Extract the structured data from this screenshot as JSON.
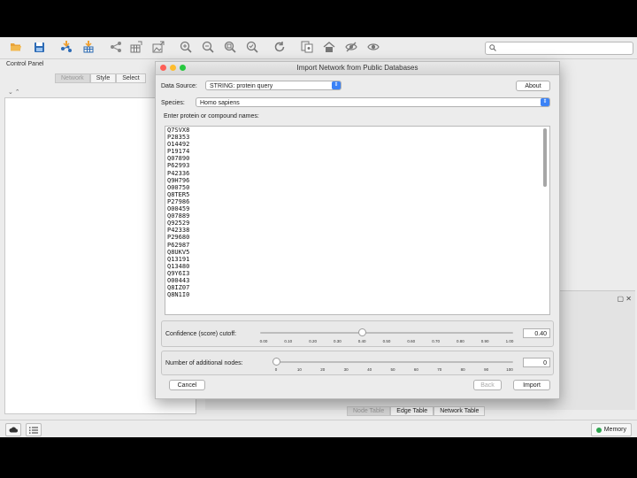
{
  "app": {
    "control_panel": {
      "title": "Control Panel",
      "tabs": [
        "Network",
        "Style",
        "Select"
      ],
      "tools": "⌄ ⌃"
    },
    "bottom_tabs": [
      "Node Table",
      "Edge Table",
      "Network Table"
    ],
    "status": {
      "memory_label": "Memory"
    },
    "panel_icons": "▢ ✕"
  },
  "dialog": {
    "title": "Import Network from Public Databases",
    "data_source_label": "Data Source:",
    "data_source_value": "STRING: protein query",
    "about_label": "About",
    "species_label": "Species:",
    "species_value": "Homo sapiens",
    "names_label": "Enter protein or compound names:",
    "protein_ids": [
      "Q7SVX8",
      "P28353",
      "O14492",
      "P19174",
      "Q07890",
      "P62993",
      "P42336",
      "Q9H796",
      "O00750",
      "Q8TER5",
      "P27986",
      "O00459",
      "Q07889",
      "Q92529",
      "P42338",
      "P29680",
      "P62987",
      "Q8UKV5",
      "Q13191",
      "Q13480",
      "Q9Y6I3",
      "O00443",
      "Q8IZ07",
      "Q8N1I0"
    ],
    "confidence": {
      "label": "Confidence (score) cutoff:",
      "value_text": "0.40",
      "value": 0.4,
      "ticks": [
        "0.00",
        "0.10",
        "0.20",
        "0.30",
        "0.40",
        "0.50",
        "0.60",
        "0.70",
        "0.80",
        "0.90",
        "1.00"
      ]
    },
    "additional": {
      "label": "Number of additional nodes:",
      "value_text": "0",
      "value": 0,
      "ticks": [
        "0",
        "10",
        "20",
        "30",
        "40",
        "50",
        "60",
        "70",
        "80",
        "90",
        "100"
      ]
    },
    "cancel_label": "Cancel",
    "back_label": "Back",
    "import_label": "Import"
  },
  "colors": {
    "accent": "#3b82f6",
    "close": "#fe5f57",
    "minimize": "#febc2e",
    "zoom": "#28c840",
    "memory_ok": "#2ea44f"
  }
}
